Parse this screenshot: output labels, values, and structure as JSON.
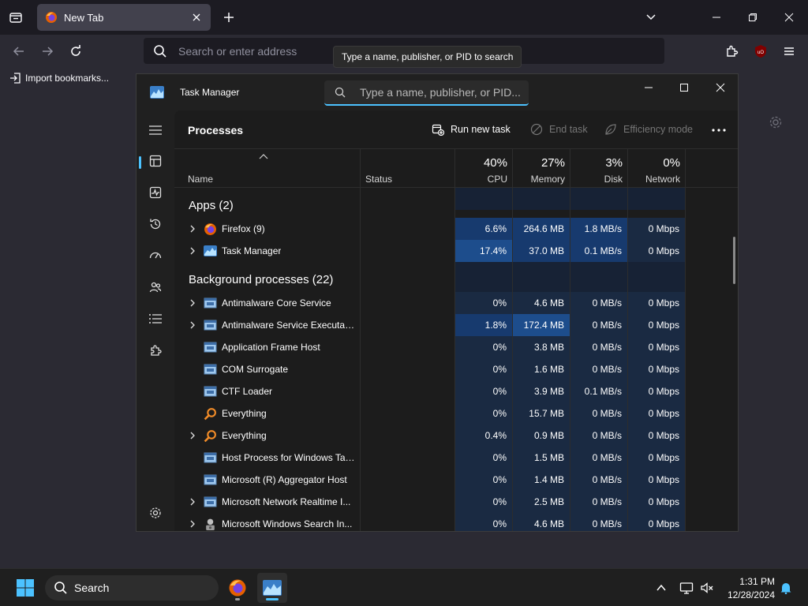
{
  "firefox": {
    "tab_title": "New Tab",
    "url_placeholder": "Search or enter address",
    "bookmark_import": "Import bookmarks...",
    "ublock_label": "uO"
  },
  "tooltip": "Type a name, publisher, or PID to search",
  "taskmanager": {
    "title": "Task Manager",
    "search_placeholder": "Type a name, publisher, or PID...",
    "page_title": "Processes",
    "toolbar": {
      "run_new_task": "Run new task",
      "end_task": "End task",
      "efficiency_mode": "Efficiency mode"
    },
    "columns": {
      "name": "Name",
      "status": "Status",
      "cpu_pct": "40%",
      "cpu": "CPU",
      "mem_pct": "27%",
      "mem": "Memory",
      "disk_pct": "3%",
      "disk": "Disk",
      "net_pct": "0%",
      "net": "Network"
    },
    "groups": {
      "apps": "Apps (2)",
      "background": "Background processes (22)"
    },
    "rows": [
      {
        "name": "Firefox (9)",
        "cpu": "6.6%",
        "mem": "264.6 MB",
        "disk": "1.8 MB/s",
        "net": "0 Mbps"
      },
      {
        "name": "Task Manager",
        "cpu": "17.4%",
        "mem": "37.0 MB",
        "disk": "0.1 MB/s",
        "net": "0 Mbps"
      },
      {
        "name": "Antimalware Core Service",
        "cpu": "0%",
        "mem": "4.6 MB",
        "disk": "0 MB/s",
        "net": "0 Mbps"
      },
      {
        "name": "Antimalware Service Executable",
        "cpu": "1.8%",
        "mem": "172.4 MB",
        "disk": "0 MB/s",
        "net": "0 Mbps"
      },
      {
        "name": "Application Frame Host",
        "cpu": "0%",
        "mem": "3.8 MB",
        "disk": "0 MB/s",
        "net": "0 Mbps"
      },
      {
        "name": "COM Surrogate",
        "cpu": "0%",
        "mem": "1.6 MB",
        "disk": "0 MB/s",
        "net": "0 Mbps"
      },
      {
        "name": "CTF Loader",
        "cpu": "0%",
        "mem": "3.9 MB",
        "disk": "0.1 MB/s",
        "net": "0 Mbps"
      },
      {
        "name": "Everything",
        "cpu": "0%",
        "mem": "15.7 MB",
        "disk": "0 MB/s",
        "net": "0 Mbps"
      },
      {
        "name": "Everything",
        "cpu": "0.4%",
        "mem": "0.9 MB",
        "disk": "0 MB/s",
        "net": "0 Mbps"
      },
      {
        "name": "Host Process for Windows Tasks",
        "cpu": "0%",
        "mem": "1.5 MB",
        "disk": "0 MB/s",
        "net": "0 Mbps"
      },
      {
        "name": "Microsoft (R) Aggregator Host",
        "cpu": "0%",
        "mem": "1.4 MB",
        "disk": "0 MB/s",
        "net": "0 Mbps"
      },
      {
        "name": "Microsoft Network Realtime I...",
        "cpu": "0%",
        "mem": "2.5 MB",
        "disk": "0 MB/s",
        "net": "0 Mbps"
      },
      {
        "name": "Microsoft Windows Search In...",
        "cpu": "0%",
        "mem": "4.6 MB",
        "disk": "0 MB/s",
        "net": "0 Mbps"
      }
    ]
  },
  "taskbar": {
    "search_label": "Search",
    "time": "1:31 PM",
    "date": "12/28/2024"
  },
  "colors": {
    "accent": "#4cc2ff",
    "heat_low": "#1a2a42",
    "heat_mid": "#173a6e",
    "heat_high": "#1d4d8c"
  }
}
